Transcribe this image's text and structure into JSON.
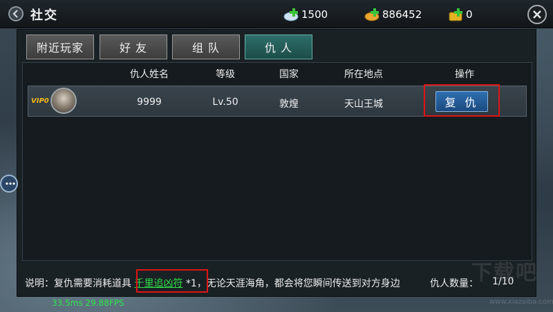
{
  "header": {
    "title": "社交",
    "currencies": [
      {
        "icon": "diamond-plus-icon",
        "value": "1500"
      },
      {
        "icon": "gold-plus-icon",
        "value": "886452"
      },
      {
        "icon": "bound-gold-plus-icon",
        "value": "0"
      }
    ]
  },
  "tabs": [
    {
      "label": "附近玩家",
      "active": false
    },
    {
      "label": "好 友",
      "active": false
    },
    {
      "label": "组 队",
      "active": false
    },
    {
      "label": "仇 人",
      "active": true
    }
  ],
  "table": {
    "columns": [
      "仇人姓名",
      "等级",
      "国家",
      "所在地点",
      "操作"
    ],
    "rows": [
      {
        "vip": "VIP0",
        "name": "9999",
        "level": "Lv.50",
        "country": "敦煌",
        "location": "天山王城",
        "action": "复 仇"
      }
    ]
  },
  "footer": {
    "prefix": "说明：复仇需要消耗道具 ",
    "item": "千里追凶符",
    "suffix": " *1，无论天涯海角，都会将您瞬间传送到对方身边",
    "count_label": "仇人数量：",
    "count_value": "1/10"
  },
  "debug": {
    "fps": "33.5ms 29.88FPS"
  },
  "watermark": {
    "text": "下载吧",
    "url": "www.xiazaiba.com"
  },
  "colors": {
    "accent_tab": "#1b4c48",
    "action_button": "#1b4a80",
    "highlight": "#e11414",
    "item_link": "#31e04a"
  }
}
